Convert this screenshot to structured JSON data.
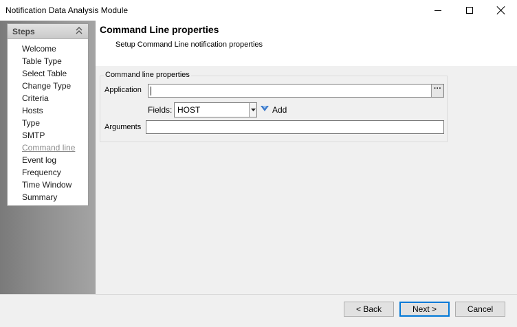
{
  "window": {
    "title": "Notification Data Analysis Module"
  },
  "sidebar": {
    "header": "Steps",
    "items": [
      {
        "label": "Welcome"
      },
      {
        "label": "Table Type"
      },
      {
        "label": "Select Table"
      },
      {
        "label": "Change Type"
      },
      {
        "label": "Criteria"
      },
      {
        "label": "Hosts"
      },
      {
        "label": "Type"
      },
      {
        "label": "SMTP"
      },
      {
        "label": "Command line",
        "current": true
      },
      {
        "label": "Event log"
      },
      {
        "label": "Frequency"
      },
      {
        "label": "Time Window"
      },
      {
        "label": "Summary"
      }
    ]
  },
  "header": {
    "title": "Command Line properties",
    "subtitle": "Setup Command Line notification properties"
  },
  "form": {
    "group_label": "Command line properties",
    "application_label": "Application",
    "application_value": "",
    "browse_label": "···",
    "fields_label": "Fields:",
    "fields_selected": "HOST",
    "add_label": "Add",
    "arguments_label": "Arguments",
    "arguments_value": ""
  },
  "footer": {
    "back_label": "< Back",
    "next_label": "Next >",
    "cancel_label": "Cancel"
  },
  "colors": {
    "accent": "#0078d7",
    "add_icon": "#3a78c9"
  }
}
